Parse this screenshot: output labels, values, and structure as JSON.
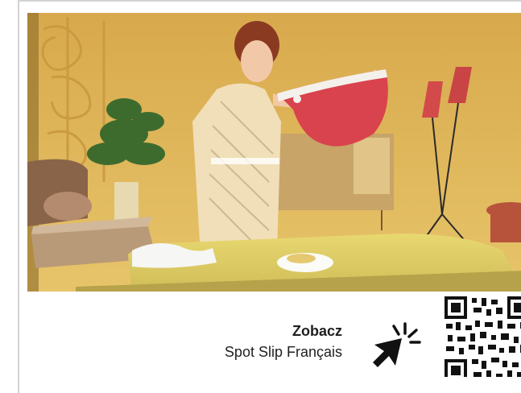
{
  "promo": {
    "title": "Zobacz",
    "subtitle": "Spot Slip Français"
  },
  "icons": {
    "cursor": "hand-pointer-click-icon",
    "qr": "qr-code-icon"
  },
  "colors": {
    "background": "#ffffff",
    "text": "#1f1f1f",
    "video_wall": "#dcb45a",
    "garment": "#d9434d"
  }
}
